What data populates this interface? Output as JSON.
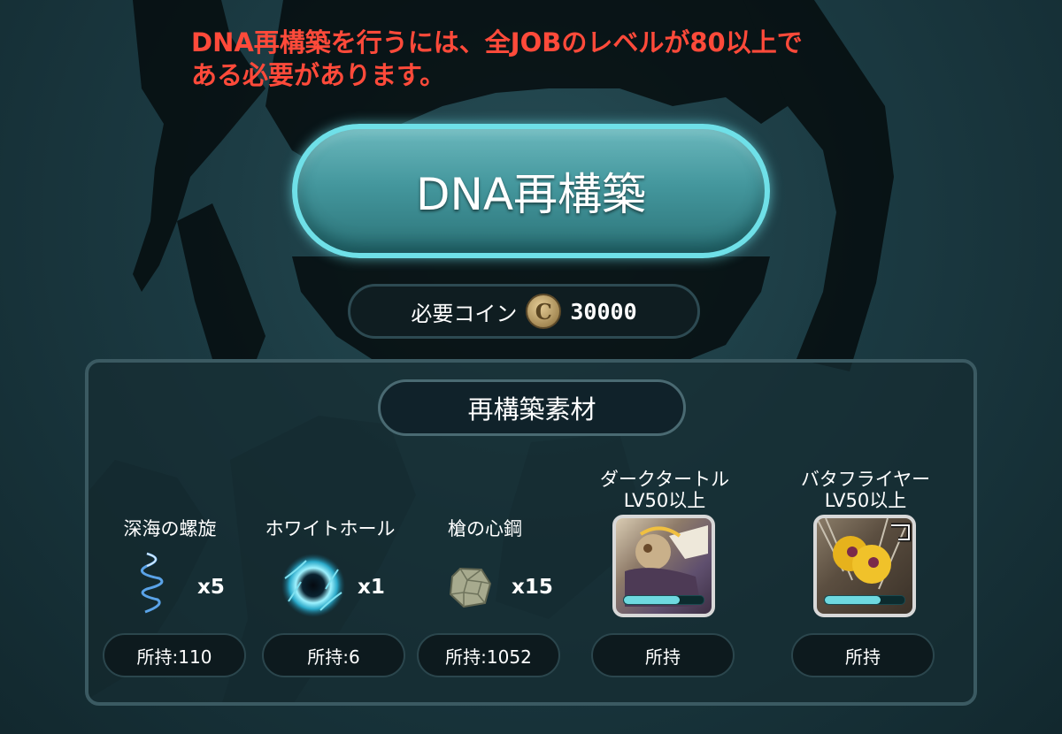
{
  "warning": {
    "line1": "DNA再構築を行うには、全JOBのレベルが80以上で",
    "line2": "ある必要があります。"
  },
  "main_button": {
    "label": "DNA再構築"
  },
  "coin": {
    "label": "必要コイン",
    "symbol": "C",
    "amount": "30000"
  },
  "materials_panel": {
    "title": "再構築素材",
    "items": [
      {
        "name": "深海の螺旋",
        "icon": "spiral-icon",
        "quantity": "x5",
        "owned": "所持:110"
      },
      {
        "name": "ホワイトホール",
        "icon": "white-hole-icon",
        "quantity": "x1",
        "owned": "所持:6"
      },
      {
        "name": "槍の心鋼",
        "icon": "ore-stone-icon",
        "quantity": "x15",
        "owned": "所持:1052"
      }
    ],
    "units": [
      {
        "name": "ダークタートル",
        "requirement": "LV50以上",
        "icon": "dark-turtle-portrait",
        "bar_fill": 0.7,
        "owned": "所持"
      },
      {
        "name": "バタフライヤー",
        "requirement": "LV50以上",
        "icon": "butterflyer-portrait",
        "bar_fill": 0.7,
        "owned": "所持"
      }
    ]
  },
  "colors": {
    "warning": "#ff4a3a",
    "button_border": "#6fe0e8",
    "button_fill": "#44979d",
    "background": "#1b3a42"
  }
}
